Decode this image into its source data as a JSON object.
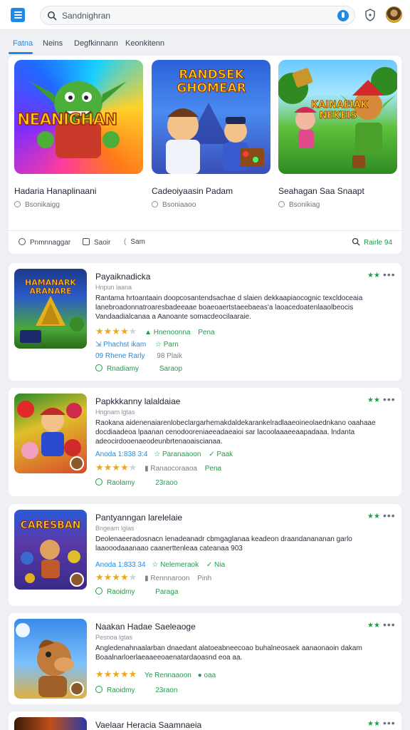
{
  "search": {
    "text": "Sandnighran"
  },
  "tabs": [
    {
      "label": "Fatna"
    },
    {
      "label": "Neins"
    },
    {
      "label": "Degfkinnann"
    },
    {
      "label": "Keonkitenn"
    }
  ],
  "featured": {
    "items": [
      {
        "image_text": "NEANIGHAN",
        "title": "Hadaria Hanaplinaani",
        "meta": "Bsonikaigg"
      },
      {
        "image_text": "RANDSEK GHOMEAR",
        "title": "Cadeoiyaasin Padam",
        "meta": "Bsoniaaoo"
      },
      {
        "image_text": "KAINAEIAK NEKEIS",
        "title": "Seahagan Saa Snaapt",
        "meta": "Bsonikiag"
      }
    ],
    "actions": [
      {
        "label": "Pnmnnaggar"
      },
      {
        "label": "Saoir"
      },
      {
        "label": "Sam"
      }
    ],
    "right_action": "Rairle 94"
  },
  "list": [
    {
      "thumb_text": "HAMANARK ARANARE",
      "title": "Payaiknadicka",
      "subtitle": "Hnpun laana",
      "description": "Rantama hrtoantaain doopcosantendsachae d slaien dekkaapiaocognic texcldoceaia lanebroadonnatroaresbadeeaae boaeoaertstaeebaeas'a laoacedoatenlaaolbeocis Vandaadialcanaa a Aanoante somacdeocilaaraie.",
      "stars_filled": 4,
      "rating_label": "Hnenoonna",
      "rating_extra": "Pena",
      "row3_left": "Phachst ikam",
      "row3_right": "Parn",
      "row4_left": "09 Rhene Rarly",
      "row4_right": "98 Plaik",
      "row5_left": "Rnadiamy",
      "row5_right": "Saraop",
      "badge": "★★"
    },
    {
      "thumb_text": "",
      "title": "Papkkkanny lalaldaiae",
      "subtitle": "Hngnam lgtas",
      "description": "Raokana aidenenaiarenlobeclargarhemakdaldekarankelradlaaeoineolaednkano oaahaae docdiaadeoa lpaanan cenodooreniaeeadaeaioi sar lacoolaaaeeaapadaaa. lndanta adeocirdooenaeodeunbrtenaoaiscianaa.",
      "row_a_left": "Anoda 1:838 3:4",
      "row_a_mid": "Paranaaoon",
      "row_a_right": "Paak",
      "stars_filled": 4,
      "rating_label": "Ranaocoraaoa",
      "rating_extra": "Pena",
      "row5_left": "Raolamy",
      "row5_right": "23raoo",
      "badge": "★★"
    },
    {
      "thumb_text": "CARESBAN",
      "title": "Pantyanngan larelelaie",
      "subtitle": "Bngeam lglas",
      "description": "Deolenaeeradosnacn lenadeanadr cbmgaglanaa keadeon draandanananan garlo laaooodaaanaao caanerttenleaa cateanaa 903",
      "row_a_left": "Anoda 1:833 34",
      "row_a_mid": "Nelemeraok",
      "row_a_right": "Nia",
      "stars_filled": 4,
      "rating_label": "Rennnaroon",
      "rating_extra": "Pinh",
      "row5_left": "Raoidmy",
      "row5_right": "Paraga",
      "badge": "★★"
    },
    {
      "thumb_text": "",
      "title": "Naakan Hadae Saeleaoge",
      "subtitle": "Pesnoa lgtas",
      "description": "Angledenahnaalarban dnaedant alatoeabneecoao buhalneosaek aanaonaoin dakam Boaalnarloerlaeaaeeoaenatardaoasnd eoa aa.",
      "stars_filled": 5,
      "rating_label": "Rennaaoon",
      "rating_extra": "oaa",
      "row5_left": "Raoidmy",
      "row5_right": "23raon",
      "badge": "★★"
    },
    {
      "thumb_text": "",
      "title": "Vaelaar Heracia Saamnaeia",
      "badge": "★★"
    }
  ]
}
